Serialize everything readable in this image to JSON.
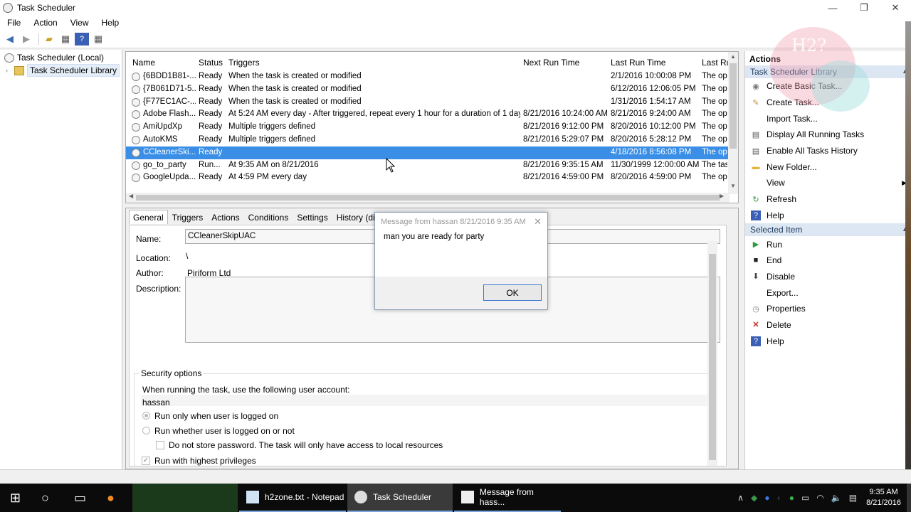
{
  "window": {
    "title": "Task Scheduler",
    "controls": [
      "—",
      "❐",
      "✕"
    ]
  },
  "menu": [
    "File",
    "Action",
    "View",
    "Help"
  ],
  "tree": {
    "root": "Task Scheduler (Local)",
    "child": "Task Scheduler Library"
  },
  "task_list": {
    "columns": [
      "Name",
      "Status",
      "Triggers",
      "Next Run Time",
      "Last Run Time",
      "Last Ru"
    ],
    "rows": [
      {
        "name": "{6BDD1B81-...",
        "status": "Ready",
        "triggers": "When the task is created or modified",
        "next": "",
        "last": "2/1/2016 10:00:08 PM",
        "result": "The op"
      },
      {
        "name": "{7B061D71-5...",
        "status": "Ready",
        "triggers": "When the task is created or modified",
        "next": "",
        "last": "6/12/2016 12:06:05 PM",
        "result": "The op"
      },
      {
        "name": "{F77EC1AC-...",
        "status": "Ready",
        "triggers": "When the task is created or modified",
        "next": "",
        "last": "1/31/2016 1:54:17 AM",
        "result": "The op"
      },
      {
        "name": "Adobe Flash...",
        "status": "Ready",
        "triggers": "At 5:24 AM every day - After triggered, repeat every 1 hour for a duration of 1 day.",
        "next": "8/21/2016 10:24:00 AM",
        "last": "8/21/2016 9:24:00 AM",
        "result": "The op"
      },
      {
        "name": "AmiUpdXp",
        "status": "Ready",
        "triggers": "Multiple triggers defined",
        "next": "8/21/2016 9:12:00 PM",
        "last": "8/20/2016 10:12:00 PM",
        "result": "The op"
      },
      {
        "name": "AutoKMS",
        "status": "Ready",
        "triggers": "Multiple triggers defined",
        "next": "8/21/2016 5:29:07 PM",
        "last": "8/20/2016 5:28:12 PM",
        "result": "The op"
      },
      {
        "name": "CCleanerSki...",
        "status": "Ready",
        "triggers": "",
        "next": "",
        "last": "4/18/2016 8:56:08 PM",
        "result": "The op"
      },
      {
        "name": "go_to_party",
        "status": "Run...",
        "triggers": "At 9:35 AM on 8/21/2016",
        "next": "8/21/2016 9:35:15 AM",
        "last": "11/30/1999 12:00:00 AM",
        "result": "The tas"
      },
      {
        "name": "GoogleUpda...",
        "status": "Ready",
        "triggers": "At 4:59 PM every day",
        "next": "8/21/2016 4:59:00 PM",
        "last": "8/20/2016 4:59:00 PM",
        "result": "The op"
      }
    ]
  },
  "details": {
    "tabs": [
      "General",
      "Triggers",
      "Actions",
      "Conditions",
      "Settings",
      "History (disable"
    ],
    "name_label": "Name:",
    "name_value": "CCleanerSkipUAC",
    "location_label": "Location:",
    "location_value": "\\",
    "author_label": "Author:",
    "author_value": "Piriform Ltd",
    "description_label": "Description:",
    "security_label": "Security options",
    "account_prompt": "When running the task, use the following user account:",
    "account": "hassan",
    "opt_logged_on": "Run only when user is logged on",
    "opt_whether": "Run whether user is logged on or not",
    "opt_no_password": "Do not store password.  The task will only have access to local resources",
    "opt_highest": "Run with highest privileges"
  },
  "dialog": {
    "title": "Message from hassan 8/21/2016 9:35 AM",
    "message": "man you are ready for party",
    "ok": "OK"
  },
  "actions": {
    "header": "Actions",
    "section1": "Task Scheduler Library",
    "items1": [
      "Create Basic Task...",
      "Create Task...",
      "Import Task...",
      "Display All Running Tasks",
      "Enable All Tasks History",
      "New Folder...",
      "View",
      "Refresh",
      "Help"
    ],
    "section2": "Selected Item",
    "items2": [
      "Run",
      "End",
      "Disable",
      "Export...",
      "Properties",
      "Delete",
      "Help"
    ]
  },
  "watermark_text": "H2?",
  "taskbar": {
    "apps": [
      "h2zone.txt - Notepad",
      "Task Scheduler",
      "Message from hass..."
    ],
    "time": "9:35 AM",
    "date": "8/21/2016"
  }
}
